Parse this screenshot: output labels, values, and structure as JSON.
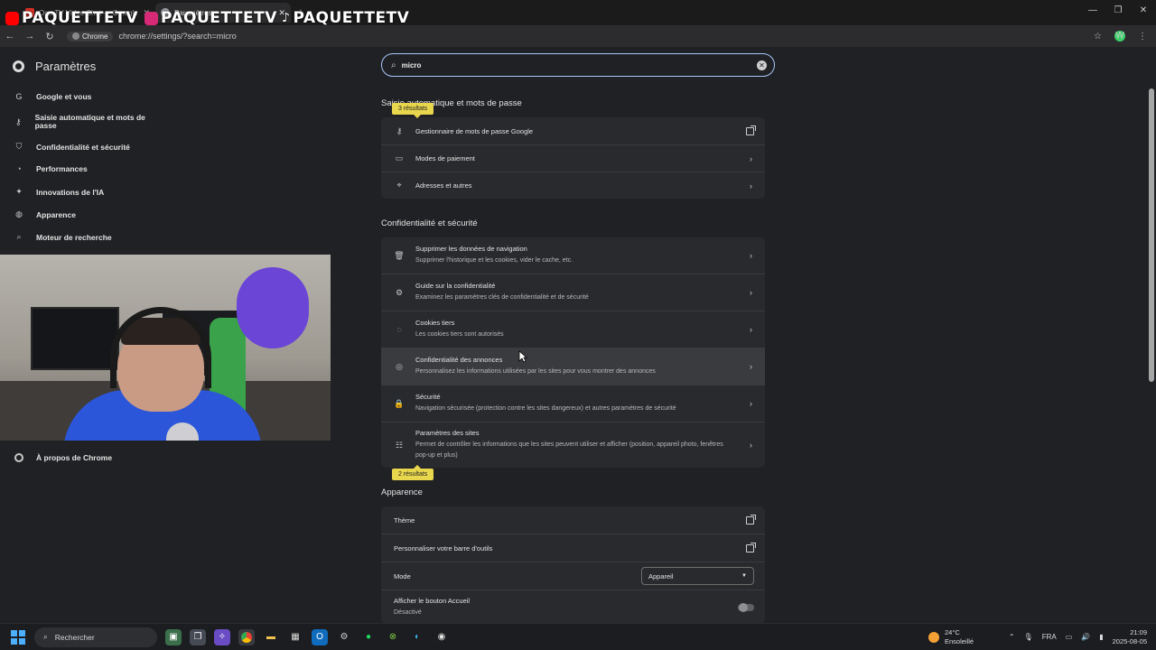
{
  "browser": {
    "tabs": [
      {
        "label": "OmeTV Video Chat — Omegle",
        "active": false,
        "color": "#d93025"
      },
      {
        "label": "Paramètres",
        "active": true,
        "color": "#9aa0a6"
      }
    ],
    "overlay_brands": [
      {
        "label": "PAQUETTETV",
        "icon": "youtube-icon",
        "color": "#ff0000"
      },
      {
        "label": "PAQUETTETV",
        "icon": "instagram-icon",
        "color": "#d62976"
      },
      {
        "label": "PAQUETTETV",
        "icon": "tiktok-icon",
        "color": "#25f4ee"
      }
    ],
    "chip_label": "Chrome",
    "url": "chrome://settings/?search=micro",
    "profile_initial": "W"
  },
  "sidebar": {
    "title": "Paramètres",
    "items": [
      {
        "label": "Google et vous",
        "icon": "google-icon"
      },
      {
        "label": "Saisie automatique et mots de passe",
        "icon": "key-icon"
      },
      {
        "label": "Confidentialité et sécurité",
        "icon": "shield-icon"
      },
      {
        "label": "Performances",
        "icon": "gauge-icon"
      },
      {
        "label": "Innovations de l'IA",
        "icon": "sparkle-icon"
      },
      {
        "label": "Apparence",
        "icon": "palette-icon"
      },
      {
        "label": "Moteur de recherche",
        "icon": "search-icon"
      }
    ],
    "about": "À propos de Chrome"
  },
  "search": {
    "value": "micro"
  },
  "sections": {
    "autofill": {
      "title": "Saisie automatique et mots de passe",
      "badge": "3 résultats",
      "rows": [
        {
          "label": "Gestionnaire de mots de passe Google",
          "action": "external"
        },
        {
          "label": "Modes de paiement",
          "action": "arrow"
        },
        {
          "label": "Adresses et autres",
          "action": "arrow"
        }
      ]
    },
    "privacy": {
      "title": "Confidentialité et sécurité",
      "badge": "2 résultats",
      "rows": [
        {
          "label": "Supprimer les données de navigation",
          "sub": "Supprimer l'historique et les cookies, vider le cache, etc."
        },
        {
          "label": "Guide sur la confidentialité",
          "sub": "Examinez les paramètres clés de confidentialité et de sécurité"
        },
        {
          "label": "Cookies tiers",
          "sub": "Les cookies tiers sont autorisés"
        },
        {
          "label": "Confidentialité des annonces",
          "sub": "Personnalisez les informations utilisées par les sites pour vous montrer des annonces"
        },
        {
          "label": "Sécurité",
          "sub": "Navigation sécurisée (protection contre les sites dangereux) et autres paramètres de sécurité"
        },
        {
          "label": "Paramètres des sites",
          "sub": "Permet de contrôler les informations que les sites peuvent utiliser et afficher (position, appareil photo, fenêtres pop-up et plus)"
        }
      ]
    },
    "appearance": {
      "title": "Apparence",
      "rows": {
        "theme": "Thème",
        "toolbar": "Personnaliser votre barre d'outils",
        "mode": "Mode",
        "mode_value": "Appareil",
        "home_button": "Afficher le bouton Accueil",
        "home_button_state": "Désactivé"
      }
    }
  },
  "taskbar": {
    "search_placeholder": "Rechercher",
    "weather_temp": "24°C",
    "weather_desc": "Ensoleillé",
    "language": "FRA",
    "time": "21:09",
    "date": "2025-08-05"
  }
}
